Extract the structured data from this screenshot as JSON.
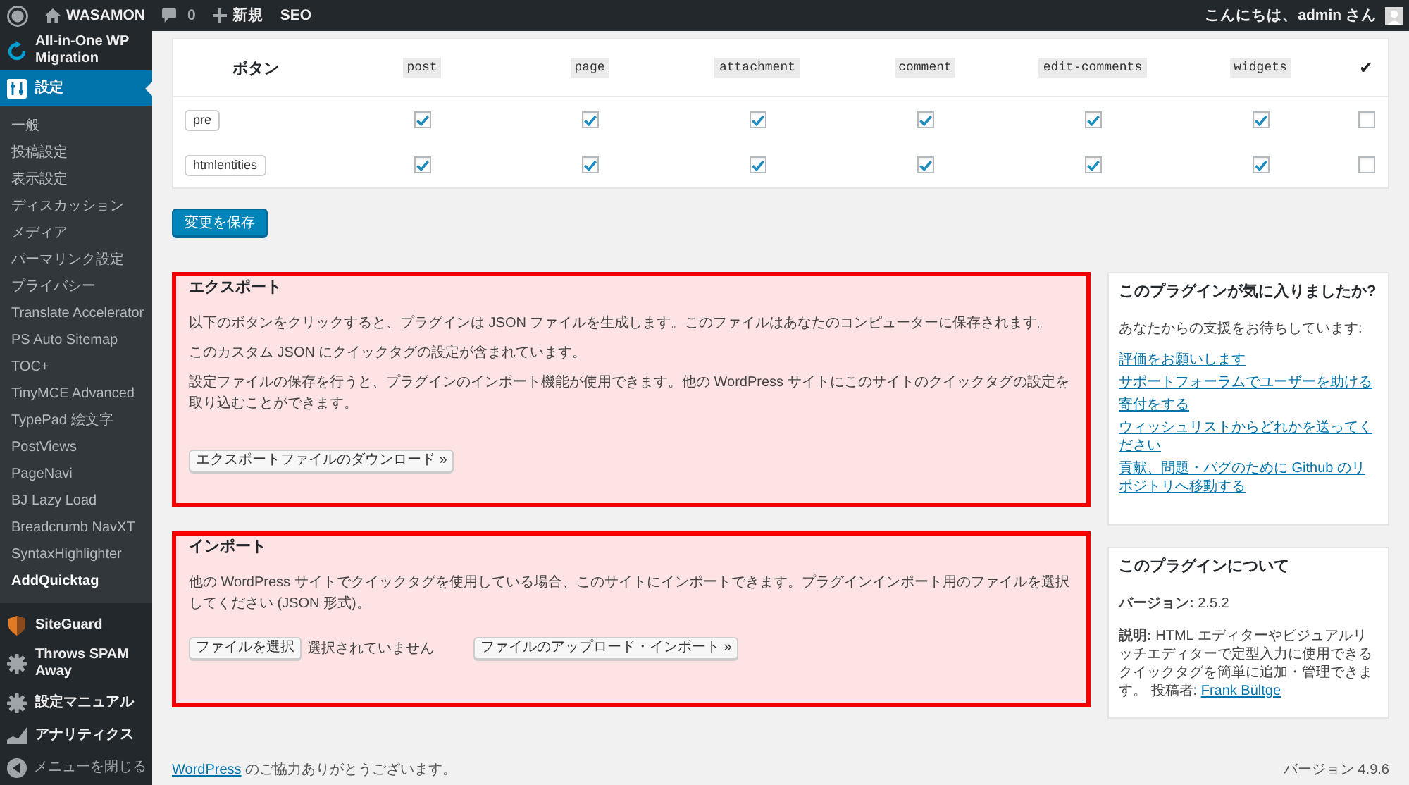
{
  "admin_bar": {
    "site_name": "WASAMON",
    "comment_count": "0",
    "new_label": "新規",
    "seo_label": "SEO",
    "greeting": "こんにちは、admin さん"
  },
  "sidebar": {
    "items": [
      {
        "label": "All-in-One WP Migration",
        "selected": false
      },
      {
        "label": "設定",
        "selected": true,
        "children": [
          {
            "label": "一般",
            "selected": false
          },
          {
            "label": "投稿設定",
            "selected": false
          },
          {
            "label": "表示設定",
            "selected": false
          },
          {
            "label": "ディスカッション",
            "selected": false
          },
          {
            "label": "メディア",
            "selected": false
          },
          {
            "label": "パーマリンク設定",
            "selected": false
          },
          {
            "label": "プライバシー",
            "selected": false
          },
          {
            "label": "Translate Accelerator",
            "selected": false
          },
          {
            "label": "PS Auto Sitemap",
            "selected": false
          },
          {
            "label": "TOC+",
            "selected": false
          },
          {
            "label": "TinyMCE Advanced",
            "selected": false
          },
          {
            "label": "TypePad 絵文字",
            "selected": false
          },
          {
            "label": "PostViews",
            "selected": false
          },
          {
            "label": "PageNavi",
            "selected": false
          },
          {
            "label": "BJ Lazy Load",
            "selected": false
          },
          {
            "label": "Breadcrumb NavXT",
            "selected": false
          },
          {
            "label": "SyntaxHighlighter",
            "selected": false
          },
          {
            "label": "AddQuicktag",
            "selected": true
          }
        ]
      },
      {
        "label": "SiteGuard",
        "selected": false
      },
      {
        "label": "Throws SPAM Away",
        "selected": false
      },
      {
        "label": "設定マニュアル",
        "selected": false
      },
      {
        "label": "アナリティクス",
        "selected": false
      }
    ],
    "collapse_label": "メニューを閉じる"
  },
  "quicktags_table": {
    "columns": [
      {
        "label": "ボタン",
        "kind": "heading"
      },
      {
        "label": "post",
        "kind": "code"
      },
      {
        "label": "page",
        "kind": "code"
      },
      {
        "label": "attachment",
        "kind": "code"
      },
      {
        "label": "comment",
        "kind": "code"
      },
      {
        "label": "edit-comments",
        "kind": "code"
      },
      {
        "label": "widgets",
        "kind": "code"
      },
      {
        "label": "✔",
        "kind": "mark"
      }
    ],
    "rows": [
      {
        "button": "pre",
        "cells": [
          {
            "checked": true
          },
          {
            "checked": true
          },
          {
            "checked": true
          },
          {
            "checked": true
          },
          {
            "checked": true
          },
          {
            "checked": true
          },
          {
            "checked": false
          }
        ]
      },
      {
        "button": "htmlentities",
        "cells": [
          {
            "checked": true
          },
          {
            "checked": true
          },
          {
            "checked": true
          },
          {
            "checked": true
          },
          {
            "checked": true
          },
          {
            "checked": true
          },
          {
            "checked": false
          }
        ]
      }
    ]
  },
  "save_button": "変更を保存",
  "export_panel": {
    "title": "エクスポート",
    "paragraphs": [
      "以下のボタンをクリックすると、プラグインは JSON ファイルを生成します。このファイルはあなたのコンピューターに保存されます。",
      "このカスタム JSON にクイックタグの設定が含まれています。",
      "設定ファイルの保存を行うと、プラグインのインポート機能が使用できます。他の WordPress サイトにこのサイトのクイックタグの設定を取り込むことができます。"
    ],
    "button": "エクスポートファイルのダウンロード »"
  },
  "import_panel": {
    "title": "インポート",
    "paragraphs": [
      "他の WordPress サイトでクイックタグを使用している場合、このサイトにインポートできます。プラグインインポート用のファイルを選択してください (JSON 形式)。"
    ],
    "file_button": "ファイルを選択",
    "file_status": "選択されていません",
    "button": "ファイルのアップロード・インポート »"
  },
  "support_box": {
    "title": "このプラグインが気に入りましたか?",
    "intro": "あなたからの支援をお待ちしています:",
    "links": [
      "評価をお願いします",
      "サポートフォーラムでユーザーを助ける",
      "寄付をする",
      "ウィッシュリストからどれかを送ってください",
      "貢献、問題・バグのために Github のリポジトリへ移動する"
    ]
  },
  "about_box": {
    "title": "このプラグインについて",
    "version": "**バージョン:** 2.5.2",
    "description": "**説明:** HTML エディターやビジュアルリッチエディターで定型入力に使用できるクイックタグを簡単に追加・管理できます。 投稿者:",
    "author_link": "Frank Bültge"
  },
  "footer": {
    "thanks_link": "WordPress",
    "thanks_text": "のご協力ありがとうございます。",
    "version": "バージョン 4.9.6"
  }
}
